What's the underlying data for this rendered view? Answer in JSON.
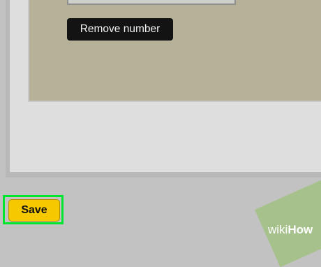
{
  "dialog": {
    "remove_number_label": "Remove number"
  },
  "footer": {
    "save_label": "Save"
  },
  "watermark": {
    "part1": "wiki",
    "part2": "How"
  },
  "colors": {
    "highlight": "#00e62e",
    "save_button": "#f5c800",
    "remove_button": "#131313"
  }
}
